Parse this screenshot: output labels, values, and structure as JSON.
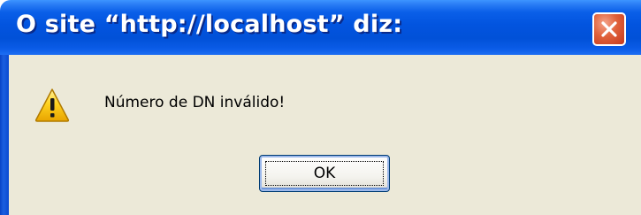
{
  "dialog": {
    "title": "O site “http://localhost” diz:",
    "message": "Número de DN inválido!",
    "ok_label": "OK"
  },
  "icons": {
    "close": "close-icon",
    "warning": "warning-icon"
  },
  "colors": {
    "titlebar": "#0254df",
    "body": "#ece9d8",
    "close_button": "#e0613a",
    "warning": "#f5c400"
  }
}
